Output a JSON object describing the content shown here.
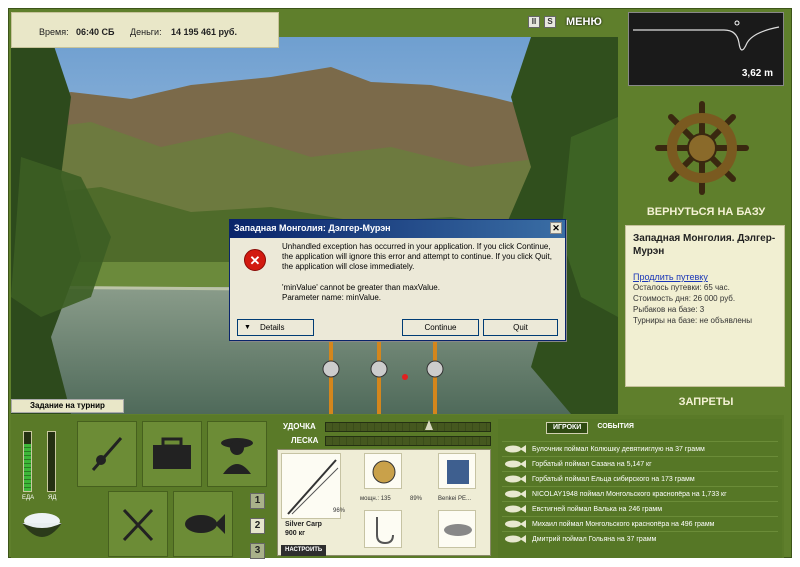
{
  "infobar": {
    "time_label": "Время:",
    "time_value": "06:40 СБ",
    "money_label": "Деньги:",
    "money_value": "14 195 461 руб."
  },
  "top_buttons": {
    "pause": "II",
    "sound": "S",
    "menu": "МЕНЮ"
  },
  "depth": {
    "value": "3,62 m"
  },
  "base": {
    "return_label": "ВЕРНУТЬСЯ НА БАЗУ",
    "bans_label": "ЗАПРЕТЫ"
  },
  "location": {
    "title": "Западная Монголия. Дэлгер-Мурэн",
    "extend_link": "Продлить путевку",
    "lines": [
      "Осталось путевки: 65 час.",
      "Стоимость дня: 26 000 руб.",
      "Рыбаков на базе: 3",
      "Турниры на базе: не объявлены"
    ]
  },
  "task": {
    "label": "Задание на турнир"
  },
  "dialog": {
    "title": "Западная Монголия: Дэлгер-Мурэн",
    "close": "✕",
    "message": "Unhandled exception has occurred in your application. If you click Continue, the application will ignore this error and attempt to continue. If you click Quit, the application will close immediately.",
    "detail_line1": "'minValue' cannot be greater than maxValue.",
    "detail_line2": "Parameter name: minValue.",
    "details_btn": "Details",
    "continue_btn": "Continue",
    "quit_btn": "Quit"
  },
  "meters": {
    "food_label": "ЕДА",
    "food_level": 0.8,
    "poison_label": "ЯД",
    "poison_level": 0.0
  },
  "bars": {
    "rod_label": "УДОЧКА",
    "line_label": "ЛЕСКА"
  },
  "slots": [
    "1",
    "2",
    "3"
  ],
  "gear": {
    "rod_name": "Silver Carp",
    "rod_weight": "900 кг",
    "rod_percent": "96%",
    "reel_power": "мощн.: 135",
    "reel_percent": "89%",
    "line_name": "Benkei PE...",
    "setup_btn": "НАСТРОИТЬ"
  },
  "events": {
    "tabs": [
      "ИГРОКИ",
      "СОБЫТИЯ"
    ],
    "items": [
      "Булочник поймал Колюшку девятииглую на 37 грамм",
      "Горбатый поймал Сазана на 5,147 кг",
      "Горбатый поймал Ельца сибирского на 173 грамм",
      "NICOLAY1948 поймал Монгольского краснопёра на 1,733 кг",
      "Евстигней поймал Валька на 246 грамм",
      "Михаил поймал Монгольского краснопёра на 496 грамм",
      "Дмитрий поймал Гольяна на 37 грамм"
    ]
  }
}
